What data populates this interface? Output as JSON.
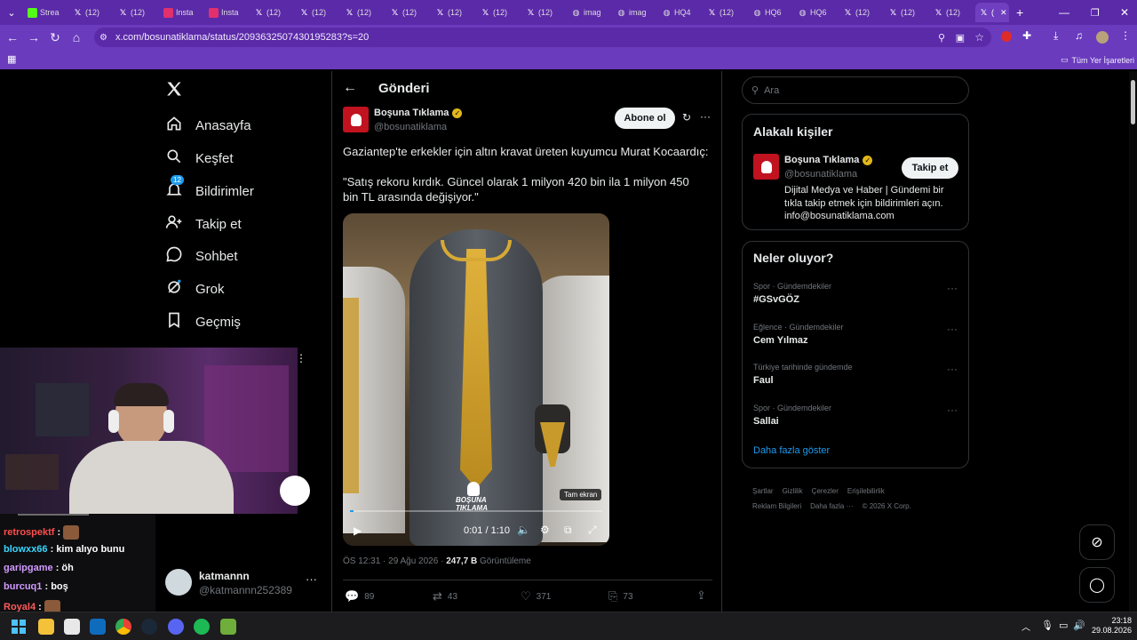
{
  "browser": {
    "tabs": [
      {
        "icon": "kick-icon",
        "label": "Strea",
        "color": "#53fc18"
      },
      {
        "icon": "x-icon",
        "label": "(12)"
      },
      {
        "icon": "x-icon",
        "label": "(12)"
      },
      {
        "icon": "instagram-icon",
        "label": "Insta",
        "color": "#e1306c"
      },
      {
        "icon": "instagram-icon",
        "label": "Insta",
        "color": "#e1306c"
      },
      {
        "icon": "x-icon",
        "label": "(12)"
      },
      {
        "icon": "x-icon",
        "label": "(12)"
      },
      {
        "icon": "x-icon",
        "label": "(12)"
      },
      {
        "icon": "x-icon",
        "label": "(12)"
      },
      {
        "icon": "x-icon",
        "label": "(12)"
      },
      {
        "icon": "x-icon",
        "label": "(12)"
      },
      {
        "icon": "x-icon",
        "label": "(12)"
      },
      {
        "icon": "globe-icon",
        "label": "imag"
      },
      {
        "icon": "globe-icon",
        "label": "imag"
      },
      {
        "icon": "globe-icon",
        "label": "HQ4"
      },
      {
        "icon": "x-icon",
        "label": "(12)"
      },
      {
        "icon": "globe-icon",
        "label": "HQ6"
      },
      {
        "icon": "globe-icon",
        "label": "HQ6"
      },
      {
        "icon": "x-icon",
        "label": "(12)"
      },
      {
        "icon": "x-icon",
        "label": "(12)"
      },
      {
        "icon": "x-icon",
        "label": "(12)"
      }
    ],
    "active_tab_label": "(",
    "url": "x.com/bosunatiklama/status/2093632507430195283?s=20",
    "bookmarks_label": "Tüm Yer İşaretleri",
    "accent": "#5b2aa8"
  },
  "nav": {
    "items": [
      {
        "label": "Anasayfa",
        "icon": "home-icon"
      },
      {
        "label": "Keşfet",
        "icon": "search-icon"
      },
      {
        "label": "Bildirimler",
        "icon": "bell-icon",
        "badge": "12"
      },
      {
        "label": "Takip et",
        "icon": "add-user-icon"
      },
      {
        "label": "Sohbet",
        "icon": "chat-icon"
      },
      {
        "label": "Grok",
        "icon": "grok-icon"
      },
      {
        "label": "Geçmiş",
        "icon": "bookmark-icon"
      }
    ],
    "account": {
      "name": "katmannn",
      "handle": "@katmannn252389"
    }
  },
  "post": {
    "header_title": "Gönderi",
    "author_name": "Boşuna Tıklama",
    "author_handle": "@bosunatiklama",
    "follow_label": "Abone ol",
    "text_line1": "Gaziantep'te erkekler için altın kravat üreten kuyumcu Murat Kocaardıç:",
    "text_line2": "\"Satış rekoru kırdık. Güncel olarak 1 milyon 420 bin ila 1 milyon 450 bin TL arasında değişiyor.\"",
    "video": {
      "time": "0:01 / 1:10",
      "fullscreen_tooltip": "Tam ekran",
      "watermark_line1": "BOŞUNA",
      "watermark_line2": "TIKLAMA",
      "progress": 0.014
    },
    "meta_time": "ÖS 12:31 · 29 Ağu 2026 · ",
    "views_value": "247,7 B",
    "views_label": " Görüntüleme",
    "stats": {
      "replies": "89",
      "reposts": "43",
      "likes": "371",
      "bookmarks": "73"
    }
  },
  "right": {
    "search_placeholder": "Ara",
    "relevant_title": "Alakalı kişiler",
    "person": {
      "name": "Boşuna Tıklama",
      "handle": "@bosunatiklama",
      "follow_label": "Takip et",
      "bio": "Dijital Medya ve Haber | Gündemi bir tıkla takip etmek için bildirimleri açın. info@bosunatiklama.com"
    },
    "trends_title": "Neler oluyor?",
    "trends": [
      {
        "category": "Spor · Gündemdekiler",
        "name": "#GSvGÖZ"
      },
      {
        "category": "Eğlence · Gündemdekiler",
        "name": "Cem Yılmaz"
      },
      {
        "category": "Türkiye tarihinde gündemde",
        "name": "Faul"
      },
      {
        "category": "Spor · Gündemdekiler",
        "name": "Sallai"
      }
    ],
    "show_more": "Daha fazla göster",
    "footer": [
      "Şartlar",
      "Gizlilik",
      "Çerezler",
      "Erişilebilirlik",
      "Reklam Bilgileri",
      "Daha fazla ···",
      "© 2026 X Corp."
    ]
  },
  "chat": [
    {
      "user": "retrospektf",
      "color": "#ff4d4d",
      "text": ""
    },
    {
      "user": "blowxx66",
      "color": "#38d6ff",
      "text": "kim alıyo bunu"
    },
    {
      "user": "garipgame",
      "color": "#d19bff",
      "text": "öh"
    },
    {
      "user": "burcuq1",
      "color": "#d19bff",
      "text": "boş"
    },
    {
      "user": "Royal4",
      "color": "#ff5a5a",
      "text": ""
    }
  ],
  "taskbar": {
    "time": "23:18",
    "date": "29.08.2026"
  }
}
